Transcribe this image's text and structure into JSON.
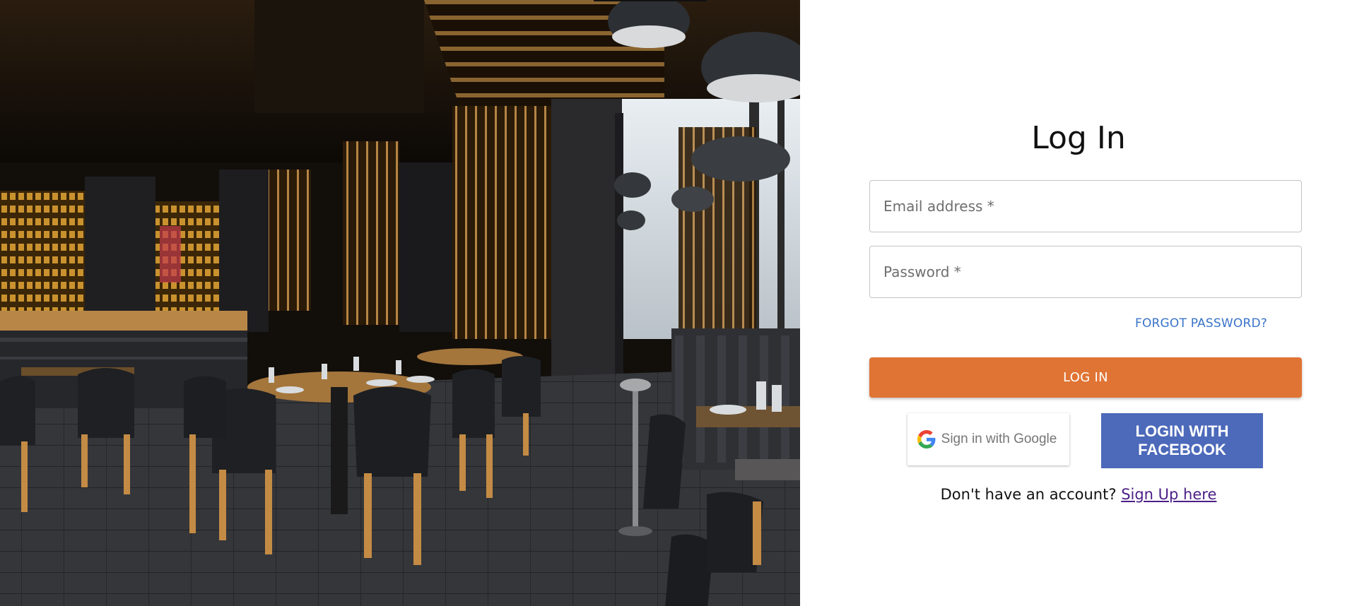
{
  "login": {
    "title": "Log In",
    "email_placeholder": "Email address *",
    "password_placeholder": "Password *",
    "forgot_password": "FORGOT PASSWORD?",
    "login_button": "LOG IN",
    "google_button": "Sign in with Google",
    "facebook_button": "LOGIN WITH FACEBOOK",
    "signup_prompt": "Don't have an account?",
    "signup_link": "Sign Up here"
  },
  "colors": {
    "accent_orange": "#e07434",
    "facebook_blue": "#4c69ba",
    "link_blue": "#3a73c9",
    "signup_link_purple": "#4b1f86"
  },
  "icons": {
    "google": "google-g-logo"
  },
  "hero_image": {
    "subject": "restaurant-interior-photo"
  }
}
